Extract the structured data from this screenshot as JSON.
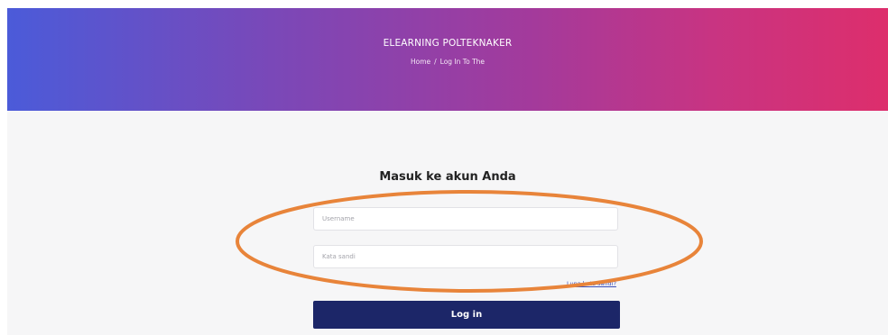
{
  "header": {
    "site_title": "ELEARNING POLTEKNAKER",
    "breadcrumb": {
      "home": "Home",
      "separator": "/",
      "current": "Log In To The"
    },
    "gradient_colors": [
      "#4b5bd9",
      "#dd2e6c"
    ]
  },
  "login_form": {
    "title": "Masuk ke akun Anda",
    "username_placeholder": "Username",
    "username_value": "",
    "password_placeholder": "Kata sandi",
    "password_value": "",
    "forgot_password_label": "Lupa kata sandi?",
    "submit_label": "Log in",
    "submit_color": "#1c2668"
  },
  "annotation": {
    "shape": "ellipse-outline",
    "color": "#e8843a"
  }
}
